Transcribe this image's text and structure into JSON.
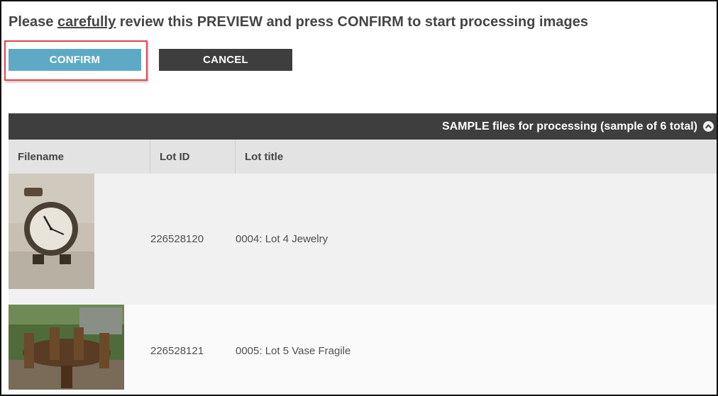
{
  "heading": {
    "pre": "Please ",
    "emph": "carefully",
    "post": " review this PREVIEW and press CONFIRM to start processing images"
  },
  "buttons": {
    "confirm_label": "CONFIRM",
    "cancel_label": "CANCEL"
  },
  "table": {
    "caption": "SAMPLE files for processing (sample of 6 total)",
    "columns": [
      "Filename",
      "Lot ID",
      "Lot title"
    ],
    "rows": [
      {
        "image": "clock-photo",
        "lot_id": "226528120",
        "lot_title": "0004: Lot 4 Jewelry"
      },
      {
        "image": "dining-table-photo",
        "lot_id": "226528121",
        "lot_title": "0005: Lot 5 Vase Fragile"
      }
    ]
  },
  "colors": {
    "confirm": "#5eaac6",
    "cancel": "#3e3e3e",
    "highlight": "#e0474c",
    "header_bar": "#3e3e3e"
  },
  "icons": {
    "collapse": "chevron-up-circle-icon"
  }
}
